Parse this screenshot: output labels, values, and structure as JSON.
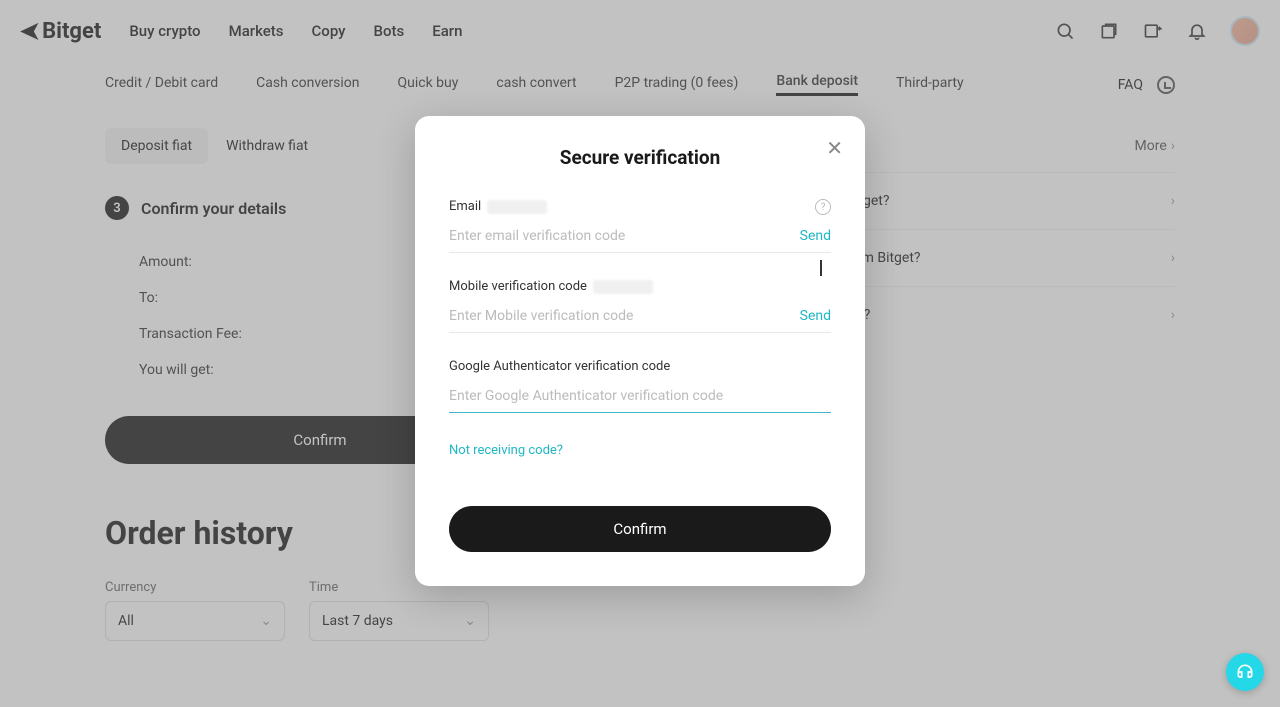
{
  "header": {
    "brand": "Bitget",
    "nav": [
      "Buy crypto",
      "Markets",
      "Copy",
      "Bots",
      "Earn"
    ]
  },
  "subtabs": {
    "items": [
      "Credit / Debit card",
      "Cash conversion",
      "Quick buy",
      "cash convert",
      "P2P trading (0 fees)",
      "Bank deposit",
      "Third-party"
    ],
    "active_index": 5,
    "faq_label": "FAQ"
  },
  "deposit": {
    "tabs": {
      "deposit": "Deposit fiat",
      "withdraw": "Withdraw fiat"
    },
    "step_number": "3",
    "step_title": "Confirm your details",
    "rows": {
      "amount": "Amount:",
      "to": "To:",
      "fee": "Transaction Fee:",
      "get": "You will get:"
    },
    "confirm": "Confirm"
  },
  "faq": {
    "more": "More",
    "items": [
      "R on Bitget?",
      "EUR from Bitget?",
      "ls arrive?"
    ]
  },
  "orders": {
    "title": "Order history",
    "currency_label": "Currency",
    "currency_value": "All",
    "time_label": "Time",
    "time_value": "Last 7 days"
  },
  "modal": {
    "title": "Secure verification",
    "email_label": "Email",
    "email_placeholder": "Enter email verification code",
    "mobile_label": "Mobile verification code",
    "mobile_placeholder": "Enter Mobile verification code",
    "send": "Send",
    "ga_label": "Google Authenticator verification code",
    "ga_placeholder": "Enter Google Authenticator verification code",
    "not_receiving": "Not receiving code?",
    "confirm": "Confirm"
  }
}
